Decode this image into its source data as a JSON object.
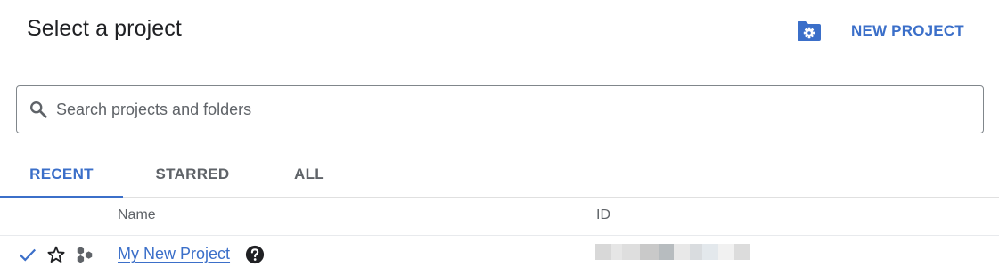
{
  "header": {
    "title": "Select a project",
    "new_project_label": "NEW PROJECT",
    "manage_icon": "folder-gear-icon"
  },
  "search": {
    "placeholder": "Search projects and folders",
    "value": "",
    "icon": "search-icon"
  },
  "tabs": [
    {
      "label": "RECENT",
      "active": true
    },
    {
      "label": "STARRED",
      "active": false
    },
    {
      "label": "ALL",
      "active": false
    }
  ],
  "table": {
    "columns": [
      "Name",
      "ID"
    ],
    "rows": [
      {
        "selected": true,
        "starred": false,
        "name": "My New Project",
        "has_help": true,
        "id_redacted": true
      }
    ]
  },
  "colors": {
    "accent": "#3b6fc9",
    "text": "#202124",
    "muted": "#5f6368",
    "border": "#80868b"
  }
}
